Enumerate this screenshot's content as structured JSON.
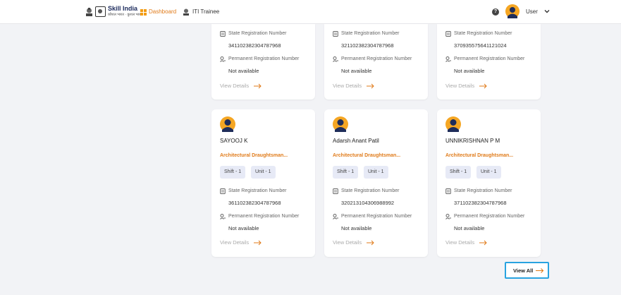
{
  "header": {
    "logo_text": "Skill India",
    "logo_sub": "कौशल भारत · कुशल भारत",
    "nav_dashboard": "Dashboard",
    "nav_iti": "ITI Trainee",
    "help_glyph": "?",
    "user_label": "User"
  },
  "labels": {
    "state_reg": "State Registration Number",
    "perm_reg": "Permanent Registration Number",
    "view_details": "View Details"
  },
  "top_cards": [
    {
      "state_reg_no": "341102382304787968",
      "perm_reg_no": "Not available"
    },
    {
      "state_reg_no": "321102382304787968",
      "perm_reg_no": "Not available"
    },
    {
      "state_reg_no": "370935575641121024",
      "perm_reg_no": "Not available"
    }
  ],
  "cards": [
    {
      "name": "SAYOOJ K",
      "course": "Architectural Draughtsman...",
      "shift": "Shift - 1",
      "unit": "Unit - 1",
      "state_reg_no": "361102382304787968",
      "perm_reg_no": "Not available"
    },
    {
      "name": "Adarsh Anant Patil",
      "course": "Architectural Draughtsman...",
      "shift": "Shift - 1",
      "unit": "Unit - 1",
      "state_reg_no": "320213104306988992",
      "perm_reg_no": "Not available"
    },
    {
      "name": "UNNIKRISHNAN P M",
      "course": "Architectural Draughtsman...",
      "shift": "Shift - 1",
      "unit": "Unit - 1",
      "state_reg_no": "371102382304787968",
      "perm_reg_no": "Not available"
    }
  ],
  "view_all_label": "View All",
  "colors": {
    "accent": "#e07b1a",
    "avatar_body": "#1f2d5a",
    "avatar_bg": "#f5a623",
    "focus_border": "#29a3e0"
  },
  "icons": [
    "dashboard-icon",
    "emblem-icon",
    "help-icon",
    "user-avatar-icon",
    "chevron-down-icon",
    "document-icon",
    "person-key-icon",
    "arrow-right-icon"
  ]
}
